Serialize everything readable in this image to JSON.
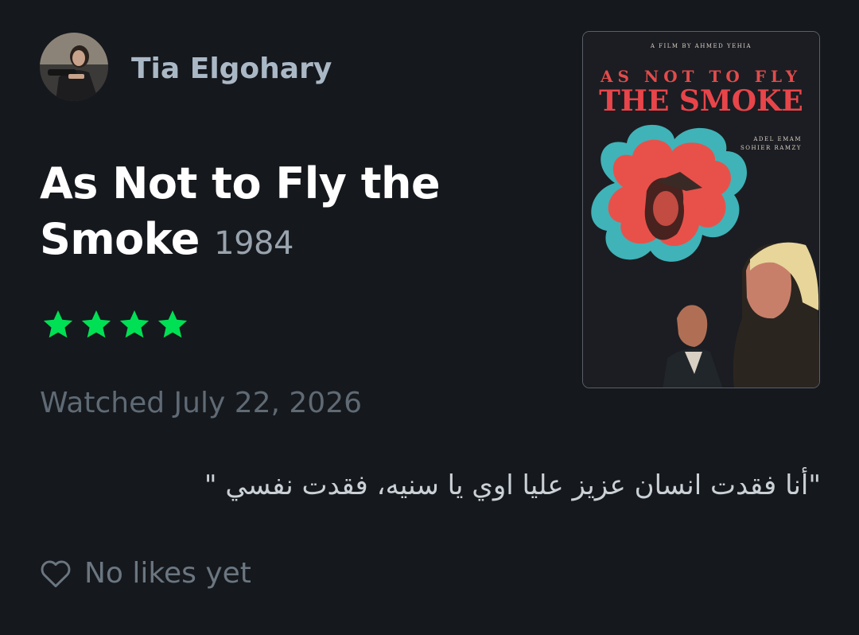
{
  "user": {
    "name": "Tia Elgohary"
  },
  "film": {
    "title": "As Not to Fly the Smoke",
    "year": "1984",
    "rating_stars": 4
  },
  "watched_text": "Watched July 22, 2026",
  "review_text": "\"أنا فقدت انسان عزيز عليا اوي يا سنيه، فقدت نفسي \"",
  "likes": {
    "icon": "heart-outline-icon",
    "label": "No likes yet"
  },
  "poster": {
    "director_credit": "A FILM BY AHMED YEHIA",
    "title_line1": "AS NOT TO FLY",
    "title_line2": "THE SMOKE",
    "cast": [
      "ADEL EMAM",
      "SOHIER RAMZY"
    ]
  },
  "colors": {
    "background": "#15181d",
    "username": "#aab8c6",
    "title": "#ffffff",
    "year": "#99a3ad",
    "star": "#00e054",
    "muted": "#5f6a74",
    "review": "#c9d0d6",
    "poster_red": "#e24b4b",
    "poster_teal": "#3fb3b8"
  }
}
